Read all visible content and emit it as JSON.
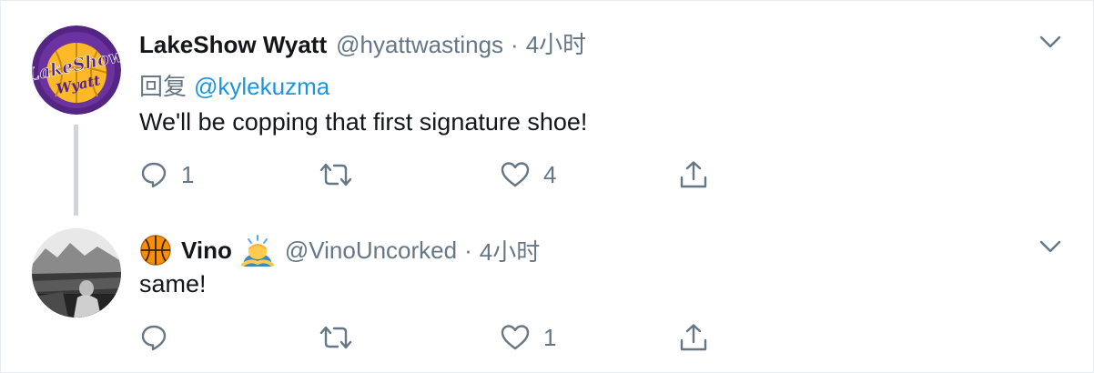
{
  "tweets": [
    {
      "name": "LakeShow Wyatt",
      "handle": "@hyattwastings",
      "separator": "·",
      "time": "4小时",
      "reply_prefix": "回复",
      "reply_mention": "@kylekuzma",
      "text": "We'll be copping that first signature shoe!",
      "avatar": {
        "line1": "LakeShow",
        "line2": "Wyatt"
      },
      "actions": {
        "reply_count": "1",
        "retweet_count": "",
        "like_count": "4"
      }
    },
    {
      "name": "Vino",
      "name_prefix_icon": "basketball-emoji",
      "name_suffix_icon": "person-bowing-emoji",
      "handle": "@VinoUncorked",
      "separator": "·",
      "time": "4小时",
      "text": "same!",
      "actions": {
        "reply_count": "",
        "retweet_count": "",
        "like_count": "1"
      }
    }
  ],
  "colors": {
    "secondary_text": "#657786",
    "link": "#1b95e0",
    "border": "#e6ecf0",
    "thread_line": "#ccd6dd",
    "avatar_purple": "#552583",
    "avatar_gold": "#fdb927"
  },
  "icons": [
    "reply-icon",
    "retweet-icon",
    "like-icon",
    "share-icon",
    "chevron-down-icon"
  ]
}
